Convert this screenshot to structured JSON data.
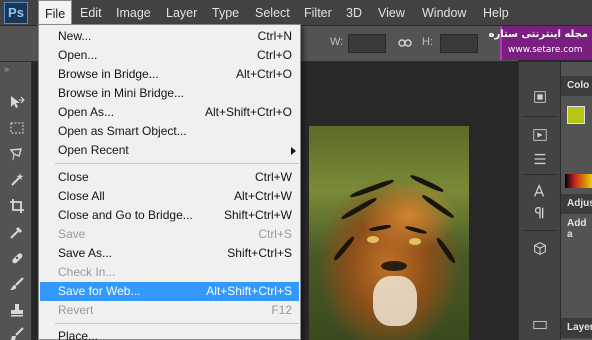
{
  "app": {
    "logo": "Ps"
  },
  "menubar": {
    "items": [
      "File",
      "Edit",
      "Image",
      "Layer",
      "Type",
      "Select",
      "Filter",
      "3D",
      "View",
      "Window",
      "Help"
    ],
    "active": "File"
  },
  "options_bar": {
    "width_label": "W:",
    "height_label": "H:"
  },
  "watermark": {
    "title": "مجله اینترنتی ستاره",
    "url": "www.setare.com",
    "color": "#7a1f7f"
  },
  "file_menu": {
    "items": [
      {
        "label": "New...",
        "shortcut": "Ctrl+N"
      },
      {
        "label": "Open...",
        "shortcut": "Ctrl+O"
      },
      {
        "label": "Browse in Bridge...",
        "shortcut": "Alt+Ctrl+O"
      },
      {
        "label": "Browse in Mini Bridge...",
        "shortcut": ""
      },
      {
        "label": "Open As...",
        "shortcut": "Alt+Shift+Ctrl+O"
      },
      {
        "label": "Open as Smart Object...",
        "shortcut": ""
      },
      {
        "label": "Open Recent",
        "shortcut": "",
        "submenu": true
      },
      {
        "label": "Close",
        "shortcut": "Ctrl+W"
      },
      {
        "label": "Close All",
        "shortcut": "Alt+Ctrl+W"
      },
      {
        "label": "Close and Go to Bridge...",
        "shortcut": "Shift+Ctrl+W"
      },
      {
        "label": "Save",
        "shortcut": "Ctrl+S",
        "disabled": true
      },
      {
        "label": "Save As...",
        "shortcut": "Shift+Ctrl+S"
      },
      {
        "label": "Check In...",
        "shortcut": "",
        "disabled": true
      },
      {
        "label": "Save for Web...",
        "shortcut": "Alt+Shift+Ctrl+S",
        "highlighted": true
      },
      {
        "label": "Revert",
        "shortcut": "F12",
        "disabled": true
      },
      {
        "label": "Place...",
        "shortcut": ""
      }
    ],
    "highlight_color": "#3399ff"
  },
  "right_panel": {
    "color_tab": "Colo",
    "adjustments_tab": "Adjus",
    "adjustments_text": "Add a",
    "layers_tab": "Layers",
    "foreground_color": "#b8c419"
  }
}
